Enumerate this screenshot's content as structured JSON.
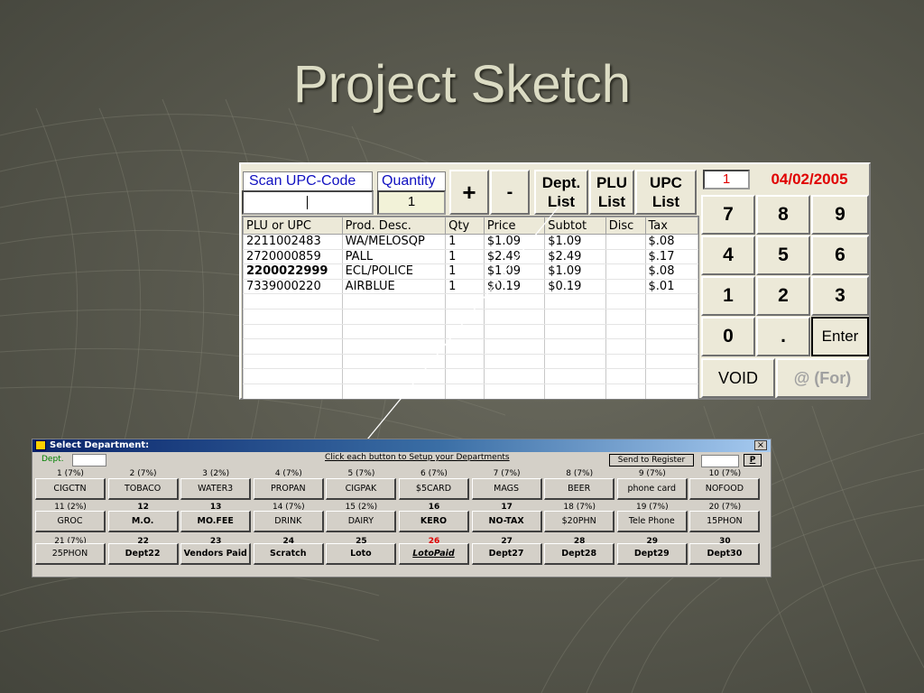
{
  "slide": {
    "title": "Project Sketch"
  },
  "pos": {
    "scan_label": "Scan UPC-Code",
    "scan_value": "",
    "qty_label": "Quantity",
    "qty_value": "1",
    "plus_label": "+",
    "minus_label": "-",
    "dept_list_line1": "Dept.",
    "dept_list_line2": "List",
    "plu_list_line1": "PLU",
    "plu_list_line2": "List",
    "upc_list_line1": "UPC",
    "upc_list_line2": "List",
    "register_no": "1",
    "date": "04/02/2005",
    "date_color": "#e00000",
    "columns": [
      "PLU or UPC",
      "Prod. Desc.",
      "Qty",
      "Price",
      "Subtot",
      "Disc",
      "Tax"
    ],
    "rows": [
      {
        "plu": "2211002483",
        "desc": "WA/MELOSQP",
        "qty": "1",
        "price": "$1.09",
        "subtot": "$1.09",
        "disc": "",
        "tax": "$.08",
        "bold": false
      },
      {
        "plu": "2720000859",
        "desc": "PALL",
        "qty": "1",
        "price": "$2.49",
        "subtot": "$2.49",
        "disc": "",
        "tax": "$.17",
        "bold": false
      },
      {
        "plu": "2200022999",
        "desc": "ECL/POLICE",
        "qty": "1",
        "price": "$1.09",
        "subtot": "$1.09",
        "disc": "",
        "tax": "$.08",
        "bold": true
      },
      {
        "plu": "7339000220",
        "desc": "AIRBLUE",
        "qty": "1",
        "price": "$0.19",
        "subtot": "$0.19",
        "disc": "",
        "tax": "$.01",
        "bold": false
      }
    ],
    "keypad": [
      "7",
      "8",
      "9",
      "4",
      "5",
      "6",
      "1",
      "2",
      "3",
      "0",
      ".",
      "Enter"
    ],
    "void_label": "VOID",
    "for_label": "@ (For)"
  },
  "dept_window": {
    "title": "Select Department:",
    "close_label": "×",
    "dept_label": "Dept.",
    "dept_value": "",
    "instruction": "Click each button to Setup your Departments",
    "send_label": "Send to Register",
    "p_label": "P",
    "buttons": [
      {
        "label": "1 (7%)",
        "name": "CIGCTN",
        "bold": false
      },
      {
        "label": "2 (7%)",
        "name": "TOBACO",
        "bold": false
      },
      {
        "label": "3 (2%)",
        "name": "WATER3",
        "bold": false
      },
      {
        "label": "4 (7%)",
        "name": "PROPAN",
        "bold": false
      },
      {
        "label": "5 (7%)",
        "name": "CIGPAK",
        "bold": false
      },
      {
        "label": "6 (7%)",
        "name": "$5CARD",
        "bold": false
      },
      {
        "label": "7 (7%)",
        "name": "MAGS",
        "bold": false
      },
      {
        "label": "8 (7%)",
        "name": "BEER",
        "bold": false
      },
      {
        "label": "9 (7%)",
        "name": "phone card",
        "bold": false
      },
      {
        "label": "10 (7%)",
        "name": "NOFOOD",
        "bold": false
      },
      {
        "label": "11 (2%)",
        "name": "GROC",
        "bold": false
      },
      {
        "label": "12",
        "name": "M.O.",
        "bold": true
      },
      {
        "label": "13",
        "name": "MO.FEE",
        "bold": true
      },
      {
        "label": "14 (7%)",
        "name": "DRINK",
        "bold": false
      },
      {
        "label": "15 (2%)",
        "name": "DAIRY",
        "bold": false
      },
      {
        "label": "16",
        "name": "KERO",
        "bold": true
      },
      {
        "label": "17",
        "name": "NO-TAX",
        "bold": true
      },
      {
        "label": "18 (7%)",
        "name": "$20PHN",
        "bold": false
      },
      {
        "label": "19 (7%)",
        "name": "Tele Phone",
        "bold": false
      },
      {
        "label": "20 (7%)",
        "name": "15PHON",
        "bold": false
      },
      {
        "label": "21 (7%)",
        "name": "25PHON",
        "bold": false
      },
      {
        "label": "22",
        "name": "Dept22",
        "bold": true
      },
      {
        "label": "23",
        "name": "Vendors Paid",
        "bold": true
      },
      {
        "label": "24",
        "name": "Scratch",
        "bold": true
      },
      {
        "label": "25",
        "name": "Loto",
        "bold": true
      },
      {
        "label": "26",
        "name": "LotoPaid",
        "bold": true,
        "label_color": "#e00000",
        "italic_underline": true
      },
      {
        "label": "27",
        "name": "Dept27",
        "bold": true
      },
      {
        "label": "28",
        "name": "Dept28",
        "bold": true
      },
      {
        "label": "29",
        "name": "Dept29",
        "bold": true
      },
      {
        "label": "30",
        "name": "Dept30",
        "bold": true
      }
    ]
  }
}
